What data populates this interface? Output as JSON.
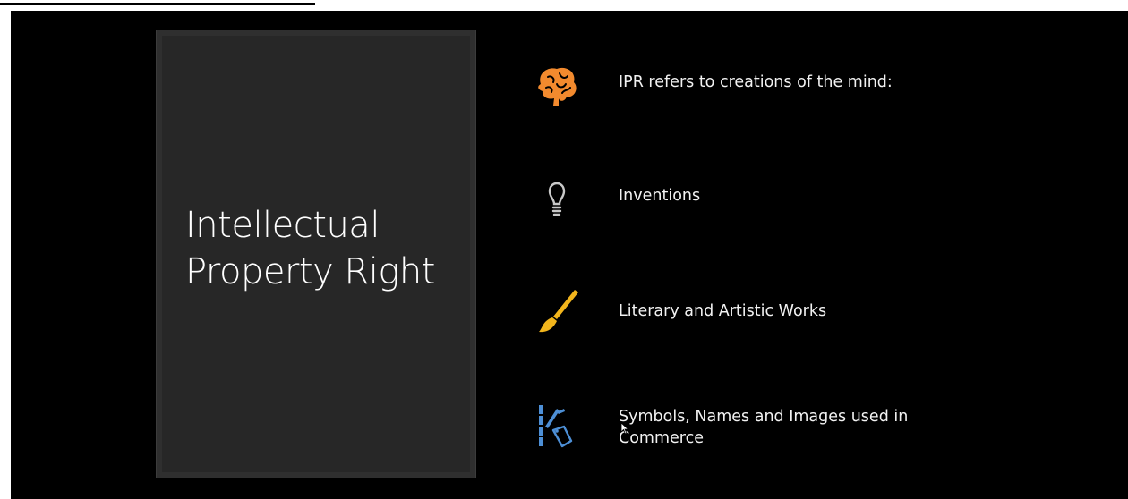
{
  "slide": {
    "title": "Intellectual Property Right",
    "colors": {
      "background": "#000000",
      "title_box": "#272727",
      "text": "#f2f2f2",
      "brain": "#f28a2e",
      "bulb": "#c8c8c8",
      "brush_handle": "#f2b51c",
      "bamboo": "#4d8fd6"
    },
    "items": [
      {
        "icon": "brain-icon",
        "label": "IPR refers to creations of the mind:"
      },
      {
        "icon": "lightbulb-icon",
        "label": "Inventions"
      },
      {
        "icon": "paintbrush-icon",
        "label": "Literary and Artistic Works"
      },
      {
        "icon": "bamboo-tag-icon",
        "label": "Symbols, Names and Images used in Commerce"
      }
    ]
  }
}
